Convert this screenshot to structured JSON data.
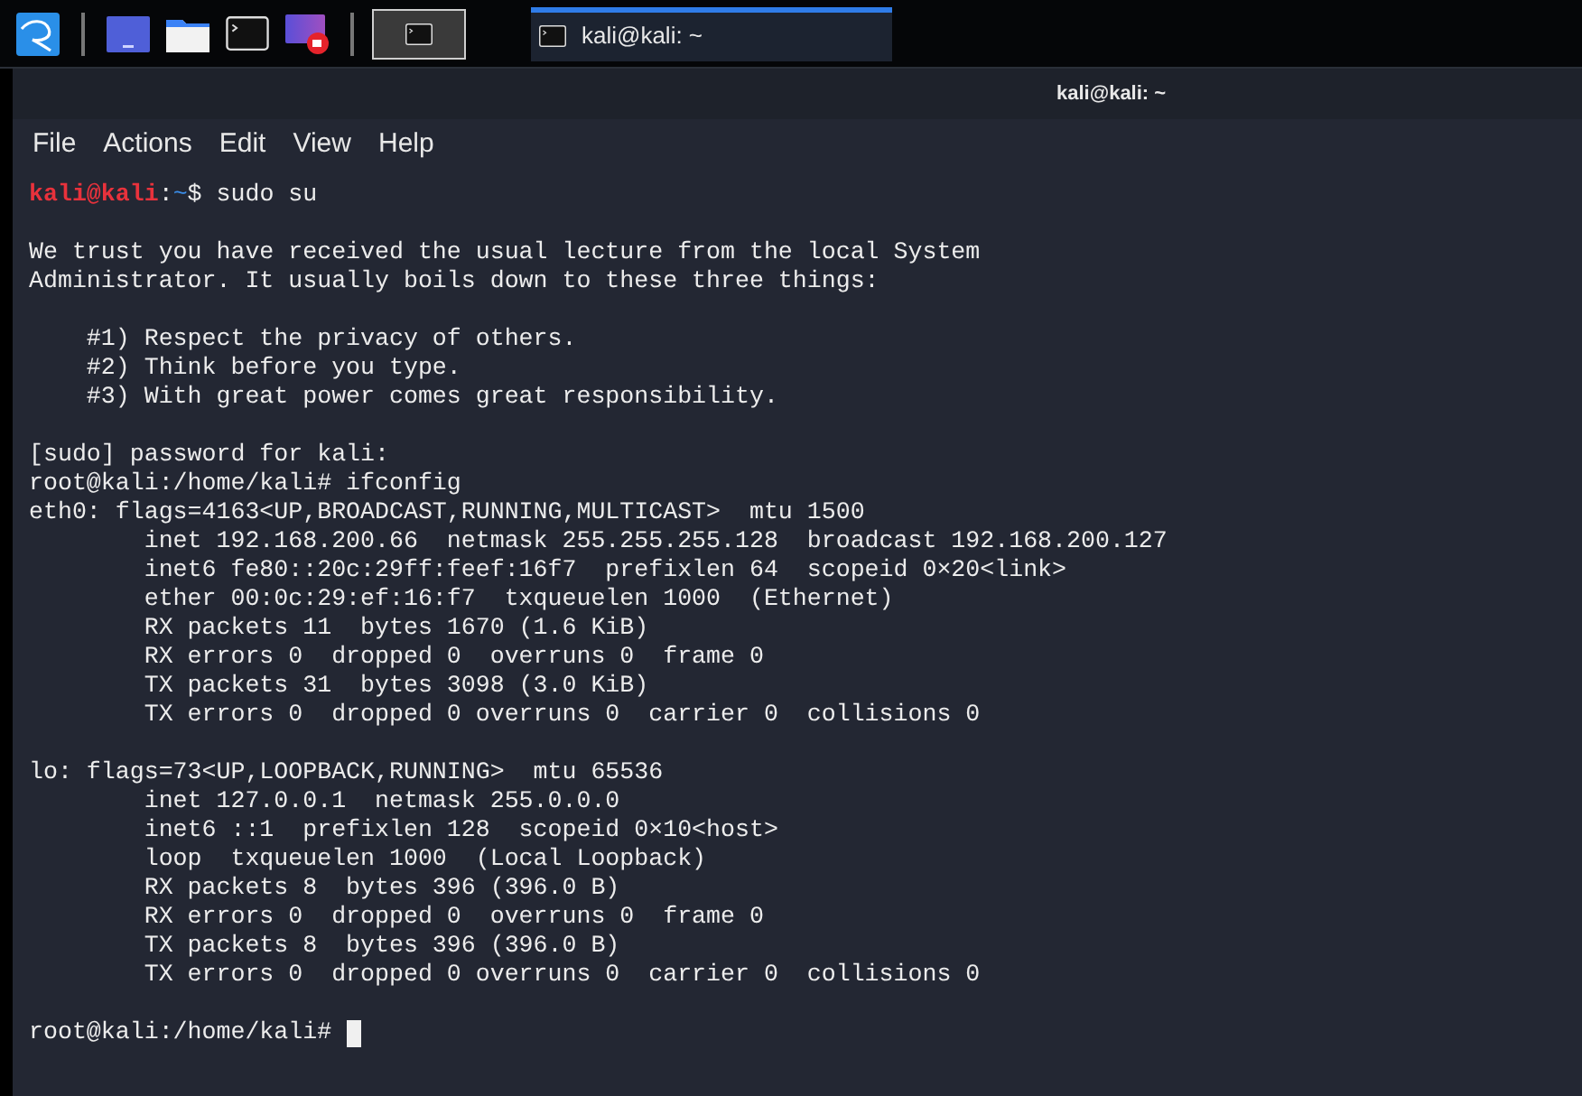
{
  "taskbar": {
    "launchers": [
      {
        "kind": "desktop"
      },
      {
        "kind": "folder"
      },
      {
        "kind": "terminal"
      },
      {
        "kind": "recorder"
      }
    ],
    "tasks": [
      {
        "kind": "icon-only",
        "selected": false
      },
      {
        "kind": "labeled",
        "label": "kali@kali: ~",
        "selected": true
      }
    ]
  },
  "window": {
    "title": "kali@kali: ~"
  },
  "menu": [
    "File",
    "Actions",
    "Edit",
    "View",
    "Help"
  ],
  "terminal": {
    "blocks": [
      [
        {
          "kind": "user_prompt",
          "user": "kali@kali",
          "sep": ":",
          "path": "~",
          "symbol": "$",
          "command": " sudo su"
        }
      ],
      [
        {
          "kind": "text",
          "text": "We trust you have received the usual lecture from the local System"
        },
        {
          "kind": "text",
          "text": "Administrator. It usually boils down to these three things:"
        }
      ],
      [
        {
          "kind": "text",
          "text": "    #1) Respect the privacy of others."
        },
        {
          "kind": "text",
          "text": "    #2) Think before you type."
        },
        {
          "kind": "text",
          "text": "    #3) With great power comes great responsibility."
        }
      ],
      [
        {
          "kind": "text",
          "text": "[sudo] password for kali:"
        },
        {
          "kind": "root_prompt",
          "prompt": "root@kali:/home/kali#",
          "command": " ifconfig"
        },
        {
          "kind": "text",
          "text": "eth0: flags=4163<UP,BROADCAST,RUNNING,MULTICAST>  mtu 1500"
        },
        {
          "kind": "text",
          "text": "        inet 192.168.200.66  netmask 255.255.255.128  broadcast 192.168.200.127"
        },
        {
          "kind": "text",
          "text": "        inet6 fe80::20c:29ff:feef:16f7  prefixlen 64  scopeid 0×20<link>"
        },
        {
          "kind": "text",
          "text": "        ether 00:0c:29:ef:16:f7  txqueuelen 1000  (Ethernet)"
        },
        {
          "kind": "text",
          "text": "        RX packets 11  bytes 1670 (1.6 KiB)"
        },
        {
          "kind": "text",
          "text": "        RX errors 0  dropped 0  overruns 0  frame 0"
        },
        {
          "kind": "text",
          "text": "        TX packets 31  bytes 3098 (3.0 KiB)"
        },
        {
          "kind": "text",
          "text": "        TX errors 0  dropped 0 overruns 0  carrier 0  collisions 0"
        }
      ],
      [
        {
          "kind": "text",
          "text": "lo: flags=73<UP,LOOPBACK,RUNNING>  mtu 65536"
        },
        {
          "kind": "text",
          "text": "        inet 127.0.0.1  netmask 255.0.0.0"
        },
        {
          "kind": "text",
          "text": "        inet6 ::1  prefixlen 128  scopeid 0×10<host>"
        },
        {
          "kind": "text",
          "text": "        loop  txqueuelen 1000  (Local Loopback)"
        },
        {
          "kind": "text",
          "text": "        RX packets 8  bytes 396 (396.0 B)"
        },
        {
          "kind": "text",
          "text": "        RX errors 0  dropped 0  overruns 0  frame 0"
        },
        {
          "kind": "text",
          "text": "        TX packets 8  bytes 396 (396.0 B)"
        },
        {
          "kind": "text",
          "text": "        TX errors 0  dropped 0 overruns 0  carrier 0  collisions 0"
        }
      ],
      [
        {
          "kind": "root_prompt",
          "prompt": "root@kali:/home/kali#",
          "cursor": true
        }
      ]
    ]
  }
}
